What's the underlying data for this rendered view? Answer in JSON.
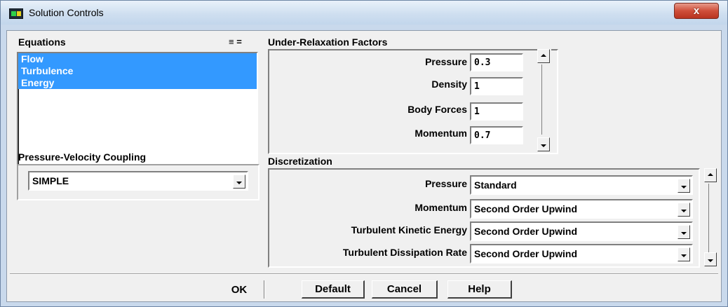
{
  "window": {
    "title": "Solution Controls",
    "close_glyph": "x"
  },
  "equations": {
    "header": "Equations",
    "list_icons": "≡ =",
    "items": [
      "Flow",
      "Turbulence",
      "Energy"
    ]
  },
  "pressure_velocity": {
    "header": "Pressure-Velocity Coupling",
    "value": "SIMPLE"
  },
  "under_relaxation": {
    "header": "Under-Relaxation Factors",
    "fields": [
      {
        "label": "Pressure",
        "value": "0.3"
      },
      {
        "label": "Density",
        "value": "1"
      },
      {
        "label": "Body Forces",
        "value": "1"
      },
      {
        "label": "Momentum",
        "value": "0.7"
      }
    ]
  },
  "discretization": {
    "header": "Discretization",
    "fields": [
      {
        "label": "Pressure",
        "value": "Standard"
      },
      {
        "label": "Momentum",
        "value": "Second Order Upwind"
      },
      {
        "label": "Turbulent Kinetic Energy",
        "value": "Second Order Upwind"
      },
      {
        "label": "Turbulent Dissipation Rate",
        "value": "Second Order Upwind"
      }
    ]
  },
  "buttons": {
    "ok": "OK",
    "default": "Default",
    "cancel": "Cancel",
    "help": "Help"
  },
  "colors": {
    "selection": "#3399ff",
    "titlebar": "#cfdff0",
    "close": "#cf4f3a"
  }
}
